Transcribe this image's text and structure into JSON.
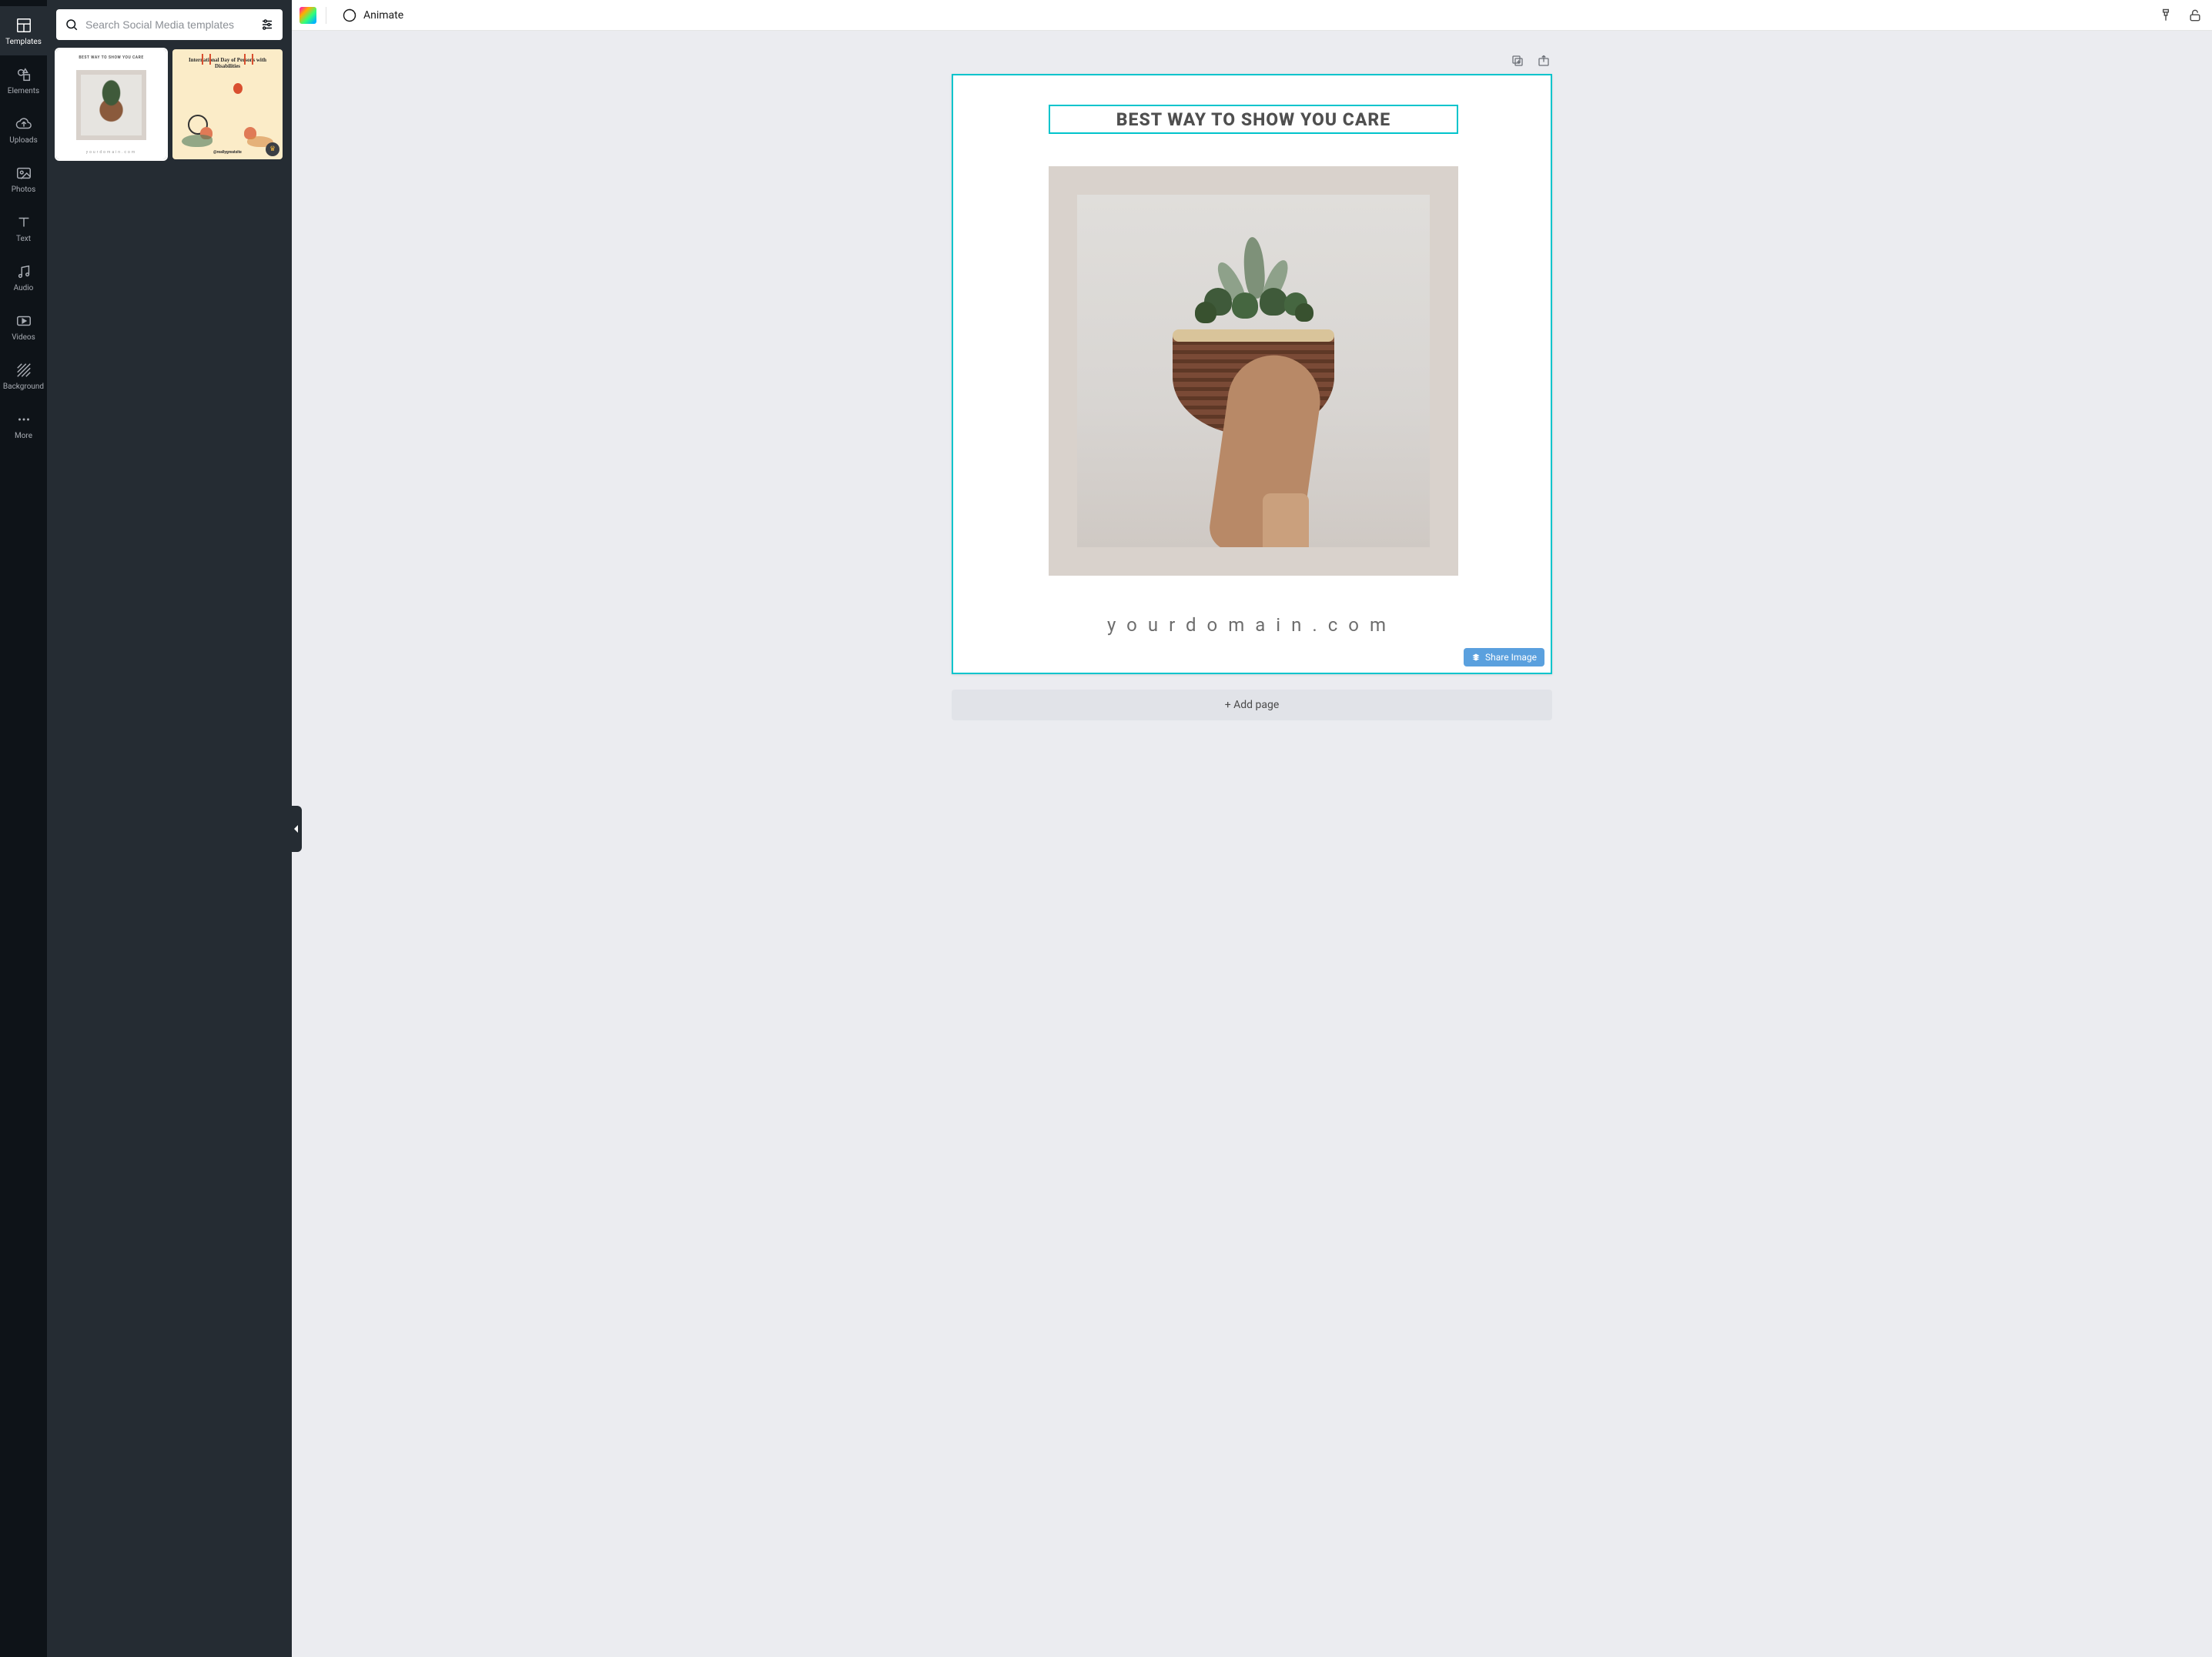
{
  "sidebar": {
    "items": [
      {
        "label": "Templates",
        "icon": "templates-icon"
      },
      {
        "label": "Elements",
        "icon": "elements-icon"
      },
      {
        "label": "Uploads",
        "icon": "uploads-icon"
      },
      {
        "label": "Photos",
        "icon": "photos-icon"
      },
      {
        "label": "Text",
        "icon": "text-icon"
      },
      {
        "label": "Audio",
        "icon": "audio-icon"
      },
      {
        "label": "Videos",
        "icon": "videos-icon"
      },
      {
        "label": "Background",
        "icon": "background-icon"
      },
      {
        "label": "More",
        "icon": "more-icon"
      }
    ],
    "active_index": 0
  },
  "panel": {
    "search_placeholder": "Search Social Media templates",
    "templates": [
      {
        "title": "BEST WAY TO SHOW YOU CARE",
        "footer": "yourdomain.com",
        "selected": true
      },
      {
        "title": "International Day of Persons with Disabilities",
        "footer": "@reallygreatsite",
        "premium": true,
        "selected": false
      }
    ]
  },
  "topbar": {
    "animate_label": "Animate"
  },
  "canvas": {
    "headline": "BEST WAY TO SHOW YOU CARE",
    "domain_text": "yourdomain.com",
    "share_label": "Share Image",
    "add_page_label": "+ Add page"
  },
  "colors": {
    "selection": "#00c4cc",
    "share_button": "#5aa0de"
  }
}
